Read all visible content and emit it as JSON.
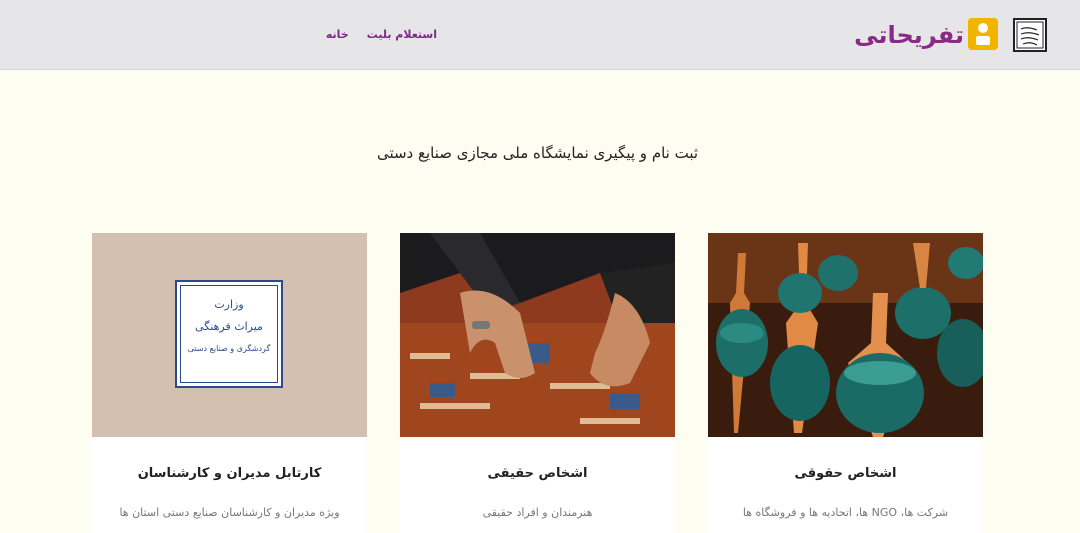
{
  "header": {
    "brand_text": "تفریحاتی",
    "nav": [
      {
        "label": "خانه"
      },
      {
        "label": "استعلام بلیت"
      }
    ]
  },
  "main": {
    "title": "ثبت نام و پیگیری نمایشگاه ملی مجازی صنایع دستی"
  },
  "cards": [
    {
      "title": "اشخاص حقوقی",
      "description": "شرکت ها، NGO ها، اتحادیه ها و فروشگاه ها",
      "image": "turquoise-copper-vases-photo"
    },
    {
      "title": "اشخاص حقیقی",
      "description": "هنرمندان و افراد حقیقی",
      "image": "carpet-weaving-hands-photo"
    },
    {
      "title": "کارتابل مدیران و کارشناسان",
      "description": "ویژه مدیران و کارشناسان صنایع دستی استان ها",
      "image": "ministry-logo"
    }
  ],
  "ministry_logo_text": [
    "وزارت",
    "میراث فرهنگی",
    "گردشگری و صنایع دستی"
  ],
  "colors": {
    "accent": "#7d2a84",
    "brand_yellow": "#f3b400",
    "background": "#fefdf2",
    "header_bg": "#e6e6e8",
    "logo_blue": "#2a4a8c"
  }
}
